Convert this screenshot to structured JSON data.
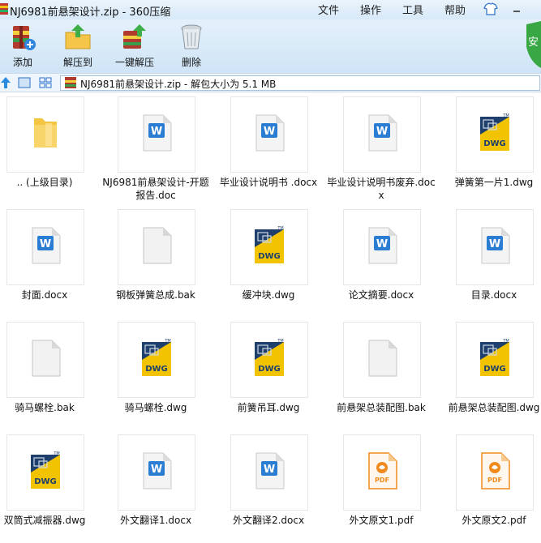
{
  "window": {
    "title": "NJ6981前悬架设计.zip - 360压缩",
    "menu": {
      "file": "文件",
      "ops": "操作",
      "tools": "工具",
      "help": "帮助"
    }
  },
  "toolbar": {
    "add": "添加",
    "extract": "解压到",
    "onekey": "一键解压",
    "delete": "删除",
    "shield_char": "安"
  },
  "address": {
    "path": "NJ6981前悬架设计.zip - 解包大小为 5.1 MB"
  },
  "files": [
    {
      "name": ".. (上级目录)",
      "icon": "folder-icon"
    },
    {
      "name": "NJ6981前悬架设计-开题报告.doc",
      "icon": "word-doc-icon"
    },
    {
      "name": "毕业设计说明书 .docx",
      "icon": "word-doc-icon"
    },
    {
      "name": "毕业设计说明书废弃.docx",
      "icon": "word-doc-icon"
    },
    {
      "name": "弹簧第一片1.dwg",
      "icon": "dwg-icon"
    },
    {
      "name": "封面.docx",
      "icon": "word-doc-icon"
    },
    {
      "name": "钢板弹簧总成.bak",
      "icon": "blank-file-icon"
    },
    {
      "name": "缓冲块.dwg",
      "icon": "dwg-icon"
    },
    {
      "name": "论文摘要.docx",
      "icon": "word-doc-icon"
    },
    {
      "name": "目录.docx",
      "icon": "word-doc-icon"
    },
    {
      "name": "骑马螺栓.bak",
      "icon": "blank-file-icon"
    },
    {
      "name": "骑马螺栓.dwg",
      "icon": "dwg-icon"
    },
    {
      "name": "前簧吊耳.dwg",
      "icon": "dwg-icon"
    },
    {
      "name": "前悬架总装配图.bak",
      "icon": "blank-file-icon"
    },
    {
      "name": "前悬架总装配图.dwg",
      "icon": "dwg-icon"
    },
    {
      "name": "双筒式减振器.dwg",
      "icon": "dwg-icon"
    },
    {
      "name": "外文翻译1.docx",
      "icon": "word-doc-icon"
    },
    {
      "name": "外文翻译2.docx",
      "icon": "word-doc-icon"
    },
    {
      "name": "外文原文1.pdf",
      "icon": "pdf-icon"
    },
    {
      "name": "外文原文2.pdf",
      "icon": "pdf-icon"
    }
  ],
  "labels": {
    "dwg": "DWG",
    "pdf": "PDF",
    "tm": "TM"
  },
  "colors": {
    "accent": "#2b6fc6",
    "pdf": "#f08a1c",
    "dwg_dark": "#1f3f6d",
    "dwg_yellow": "#f2c300"
  }
}
